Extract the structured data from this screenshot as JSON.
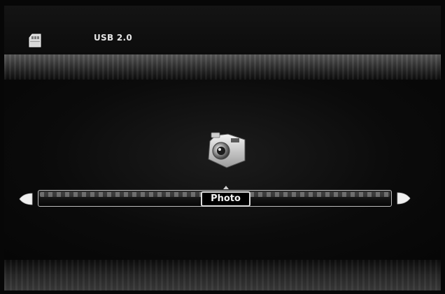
{
  "header": {
    "device_icon": "usb-drive-icon",
    "device_label": "USB 2.0"
  },
  "main": {
    "selected_icon": "camera-icon",
    "selected_label": "Photo",
    "nav": {
      "left_icon": "arrow-left-icon",
      "right_icon": "arrow-right-icon"
    }
  },
  "colors": {
    "background": "#070707",
    "text": "#f2f2f2",
    "rail_border": "#bdbdbd"
  }
}
